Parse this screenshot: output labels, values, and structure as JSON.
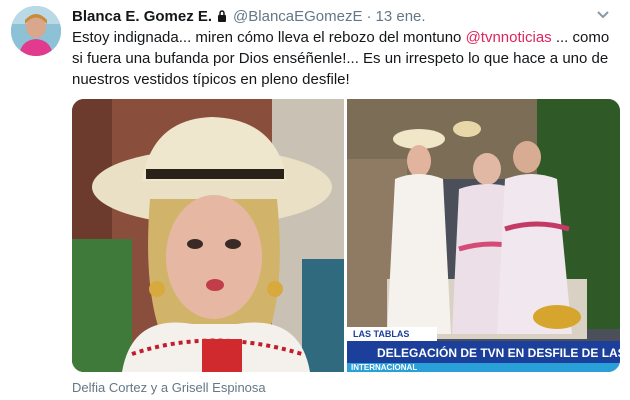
{
  "tweet": {
    "display_name": "Blanca E. Gomez E.",
    "handle": "@BlancaEGomezE",
    "separator": "·",
    "time": "13 ene.",
    "text_before": "Estoy indignada... miren cómo lleva el rebozo del montuno ",
    "mention": "@tvnnoticias",
    "text_after": " ... como si fuera una bufanda por Dios enséñenle!... Es un irrespeto lo que hace a uno de nuestros vestidos típicos en pleno desfile!",
    "media_caption": "Delfia Cortez y a Grisell Espinosa"
  },
  "tv_overlay": {
    "location_tag": "LAS TABLAS",
    "headline": "DELEGACIÓN DE TVN EN DESFILE DE LAS MIL...",
    "subline": "INTERNACIONAL"
  },
  "colors": {
    "mention": "#e0245e",
    "secondary_text": "#657786",
    "banner_blue": "#1b3f9a"
  },
  "icons": [
    "lock-icon",
    "chevron-down-icon"
  ]
}
